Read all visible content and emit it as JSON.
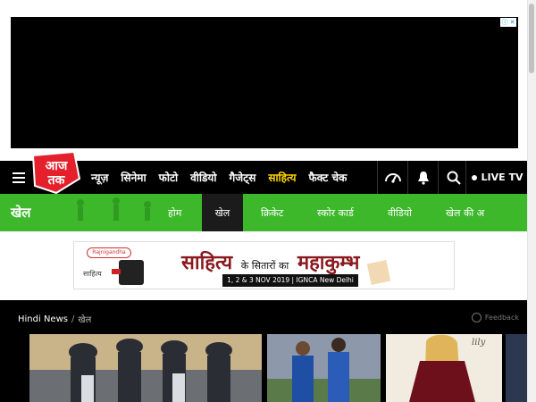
{
  "ad_top": {
    "adchoice_icons": [
      "info-icon",
      "close-icon"
    ]
  },
  "header": {
    "logo_text": "आज तक",
    "nav_links": [
      {
        "label": "न्यूज़"
      },
      {
        "label": "सिनेमा"
      },
      {
        "label": "फोटो"
      },
      {
        "label": "वीडियो"
      },
      {
        "label": "गैजेट्स"
      },
      {
        "label": "साहित्य",
        "highlight": true
      },
      {
        "label": "फैक्ट चेक"
      }
    ],
    "icons": [
      "podcast-icon",
      "bell-icon",
      "search-icon"
    ],
    "live_tv_label": "LIVE TV"
  },
  "section": {
    "title": "खेल",
    "tabs": [
      {
        "label": "होम",
        "active": false
      },
      {
        "label": "खेल",
        "active": true
      },
      {
        "label": "क्रिकेट",
        "active": false
      },
      {
        "label": "स्कोर कार्ड",
        "active": false
      },
      {
        "label": "वीडियो",
        "active": false
      },
      {
        "label": "खेल की अ",
        "active": false
      }
    ],
    "accent_color": "#3cb82a"
  },
  "banner": {
    "sponsor_logo": "Rajnigandha",
    "sponsor_sub": "साहित्य",
    "title_main": "साहित्य",
    "title_connector": "के सितारों का",
    "title_end": "महाकुम्भ",
    "date_line": "1, 2 & 3 NOV 2019 | IGNCA New Delhi"
  },
  "breadcrumb": {
    "root": "Hindi News",
    "separator": "/",
    "current": "खेल"
  },
  "feedback_label": "Feedback",
  "cards": [
    {
      "name": "cricket-team-photo"
    },
    {
      "name": "india-players-photo"
    },
    {
      "name": "woman-dress-ad"
    },
    {
      "name": "partial-card"
    }
  ],
  "colors": {
    "header_bg": "#000000",
    "highlight": "#ffd400",
    "logo_red": "#e4202c"
  }
}
